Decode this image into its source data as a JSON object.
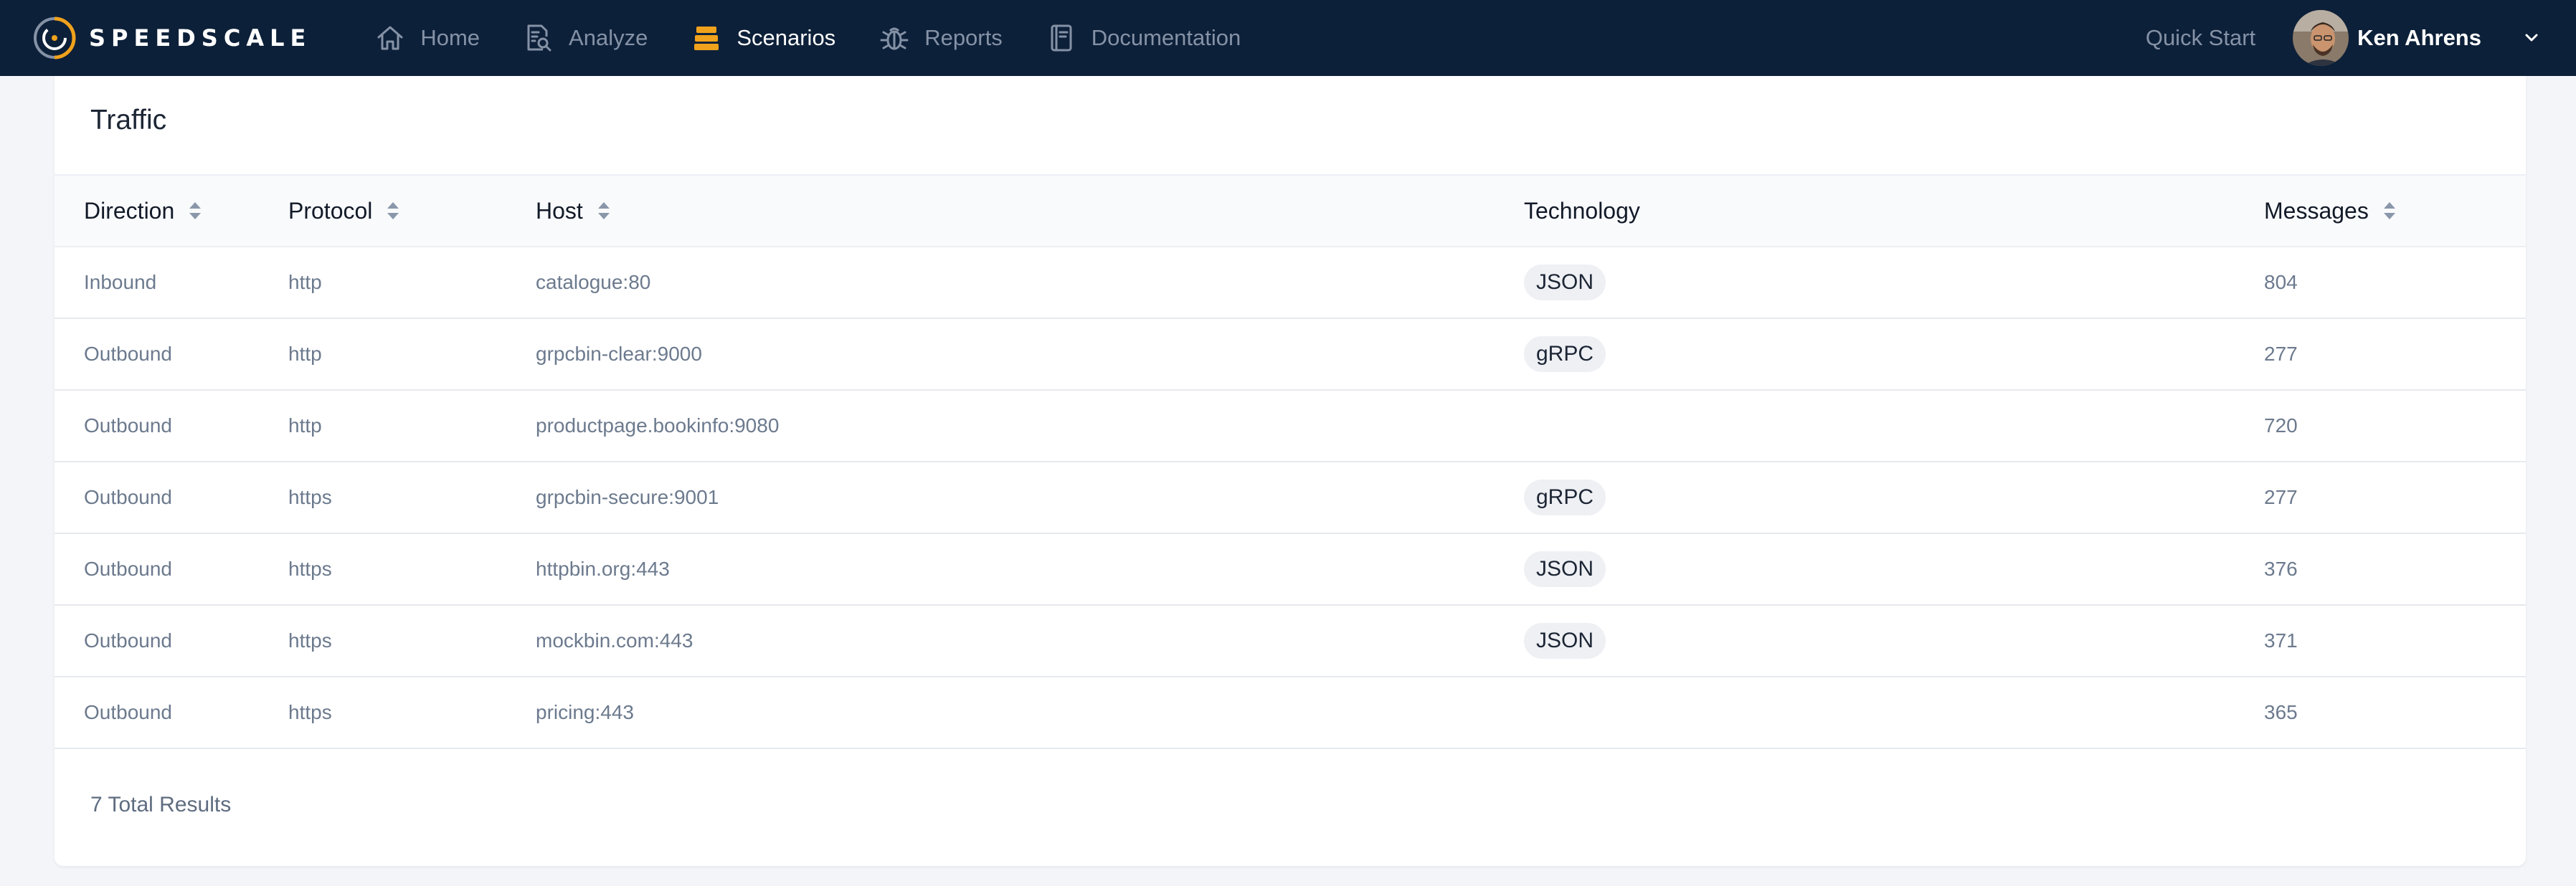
{
  "brand": {
    "name": "SPEEDSCALE"
  },
  "nav": {
    "items": [
      {
        "label": "Home",
        "icon": "home-icon"
      },
      {
        "label": "Analyze",
        "icon": "analyze-icon"
      },
      {
        "label": "Scenarios",
        "icon": "scenarios-icon",
        "active": true
      },
      {
        "label": "Reports",
        "icon": "bug-icon"
      },
      {
        "label": "Documentation",
        "icon": "document-icon"
      }
    ],
    "quick_start": "Quick Start",
    "user": {
      "name": "Ken Ahrens"
    }
  },
  "colors": {
    "topbar": "#0d2039",
    "accent": "#f0a21c",
    "badge_bg": "#eef0f4"
  },
  "card": {
    "title": "Traffic"
  },
  "table": {
    "columns": {
      "direction": "Direction",
      "protocol": "Protocol",
      "host": "Host",
      "technology": "Technology",
      "messages": "Messages"
    },
    "rows": [
      {
        "direction": "Inbound",
        "protocol": "http",
        "host": "catalogue:80",
        "technology": "JSON",
        "messages": "804"
      },
      {
        "direction": "Outbound",
        "protocol": "http",
        "host": "grpcbin-clear:9000",
        "technology": "gRPC",
        "messages": "277"
      },
      {
        "direction": "Outbound",
        "protocol": "http",
        "host": "productpage.bookinfo:9080",
        "technology": "",
        "messages": "720"
      },
      {
        "direction": "Outbound",
        "protocol": "https",
        "host": "grpcbin-secure:9001",
        "technology": "gRPC",
        "messages": "277"
      },
      {
        "direction": "Outbound",
        "protocol": "https",
        "host": "httpbin.org:443",
        "technology": "JSON",
        "messages": "376"
      },
      {
        "direction": "Outbound",
        "protocol": "https",
        "host": "mockbin.com:443",
        "technology": "JSON",
        "messages": "371"
      },
      {
        "direction": "Outbound",
        "protocol": "https",
        "host": "pricing:443",
        "technology": "",
        "messages": "365"
      }
    ],
    "total": "7 Total Results"
  }
}
